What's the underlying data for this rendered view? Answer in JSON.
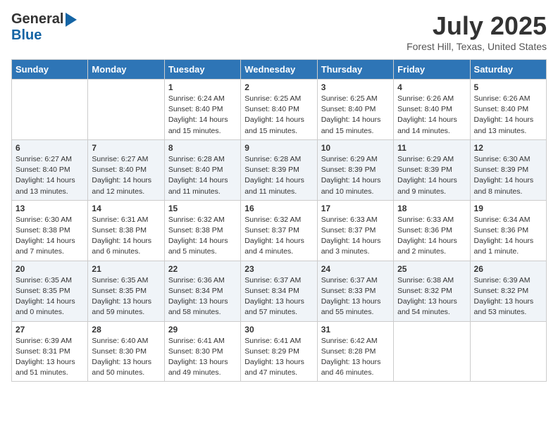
{
  "header": {
    "logo_general": "General",
    "logo_blue": "Blue",
    "month_title": "July 2025",
    "location": "Forest Hill, Texas, United States"
  },
  "days_of_week": [
    "Sunday",
    "Monday",
    "Tuesday",
    "Wednesday",
    "Thursday",
    "Friday",
    "Saturday"
  ],
  "weeks": [
    [
      {
        "day": "",
        "content": ""
      },
      {
        "day": "",
        "content": ""
      },
      {
        "day": "1",
        "content": "Sunrise: 6:24 AM\nSunset: 8:40 PM\nDaylight: 14 hours and 15 minutes."
      },
      {
        "day": "2",
        "content": "Sunrise: 6:25 AM\nSunset: 8:40 PM\nDaylight: 14 hours and 15 minutes."
      },
      {
        "day": "3",
        "content": "Sunrise: 6:25 AM\nSunset: 8:40 PM\nDaylight: 14 hours and 15 minutes."
      },
      {
        "day": "4",
        "content": "Sunrise: 6:26 AM\nSunset: 8:40 PM\nDaylight: 14 hours and 14 minutes."
      },
      {
        "day": "5",
        "content": "Sunrise: 6:26 AM\nSunset: 8:40 PM\nDaylight: 14 hours and 13 minutes."
      }
    ],
    [
      {
        "day": "6",
        "content": "Sunrise: 6:27 AM\nSunset: 8:40 PM\nDaylight: 14 hours and 13 minutes."
      },
      {
        "day": "7",
        "content": "Sunrise: 6:27 AM\nSunset: 8:40 PM\nDaylight: 14 hours and 12 minutes."
      },
      {
        "day": "8",
        "content": "Sunrise: 6:28 AM\nSunset: 8:40 PM\nDaylight: 14 hours and 11 minutes."
      },
      {
        "day": "9",
        "content": "Sunrise: 6:28 AM\nSunset: 8:39 PM\nDaylight: 14 hours and 11 minutes."
      },
      {
        "day": "10",
        "content": "Sunrise: 6:29 AM\nSunset: 8:39 PM\nDaylight: 14 hours and 10 minutes."
      },
      {
        "day": "11",
        "content": "Sunrise: 6:29 AM\nSunset: 8:39 PM\nDaylight: 14 hours and 9 minutes."
      },
      {
        "day": "12",
        "content": "Sunrise: 6:30 AM\nSunset: 8:39 PM\nDaylight: 14 hours and 8 minutes."
      }
    ],
    [
      {
        "day": "13",
        "content": "Sunrise: 6:30 AM\nSunset: 8:38 PM\nDaylight: 14 hours and 7 minutes."
      },
      {
        "day": "14",
        "content": "Sunrise: 6:31 AM\nSunset: 8:38 PM\nDaylight: 14 hours and 6 minutes."
      },
      {
        "day": "15",
        "content": "Sunrise: 6:32 AM\nSunset: 8:38 PM\nDaylight: 14 hours and 5 minutes."
      },
      {
        "day": "16",
        "content": "Sunrise: 6:32 AM\nSunset: 8:37 PM\nDaylight: 14 hours and 4 minutes."
      },
      {
        "day": "17",
        "content": "Sunrise: 6:33 AM\nSunset: 8:37 PM\nDaylight: 14 hours and 3 minutes."
      },
      {
        "day": "18",
        "content": "Sunrise: 6:33 AM\nSunset: 8:36 PM\nDaylight: 14 hours and 2 minutes."
      },
      {
        "day": "19",
        "content": "Sunrise: 6:34 AM\nSunset: 8:36 PM\nDaylight: 14 hours and 1 minute."
      }
    ],
    [
      {
        "day": "20",
        "content": "Sunrise: 6:35 AM\nSunset: 8:35 PM\nDaylight: 14 hours and 0 minutes."
      },
      {
        "day": "21",
        "content": "Sunrise: 6:35 AM\nSunset: 8:35 PM\nDaylight: 13 hours and 59 minutes."
      },
      {
        "day": "22",
        "content": "Sunrise: 6:36 AM\nSunset: 8:34 PM\nDaylight: 13 hours and 58 minutes."
      },
      {
        "day": "23",
        "content": "Sunrise: 6:37 AM\nSunset: 8:34 PM\nDaylight: 13 hours and 57 minutes."
      },
      {
        "day": "24",
        "content": "Sunrise: 6:37 AM\nSunset: 8:33 PM\nDaylight: 13 hours and 55 minutes."
      },
      {
        "day": "25",
        "content": "Sunrise: 6:38 AM\nSunset: 8:32 PM\nDaylight: 13 hours and 54 minutes."
      },
      {
        "day": "26",
        "content": "Sunrise: 6:39 AM\nSunset: 8:32 PM\nDaylight: 13 hours and 53 minutes."
      }
    ],
    [
      {
        "day": "27",
        "content": "Sunrise: 6:39 AM\nSunset: 8:31 PM\nDaylight: 13 hours and 51 minutes."
      },
      {
        "day": "28",
        "content": "Sunrise: 6:40 AM\nSunset: 8:30 PM\nDaylight: 13 hours and 50 minutes."
      },
      {
        "day": "29",
        "content": "Sunrise: 6:41 AM\nSunset: 8:30 PM\nDaylight: 13 hours and 49 minutes."
      },
      {
        "day": "30",
        "content": "Sunrise: 6:41 AM\nSunset: 8:29 PM\nDaylight: 13 hours and 47 minutes."
      },
      {
        "day": "31",
        "content": "Sunrise: 6:42 AM\nSunset: 8:28 PM\nDaylight: 13 hours and 46 minutes."
      },
      {
        "day": "",
        "content": ""
      },
      {
        "day": "",
        "content": ""
      }
    ]
  ]
}
